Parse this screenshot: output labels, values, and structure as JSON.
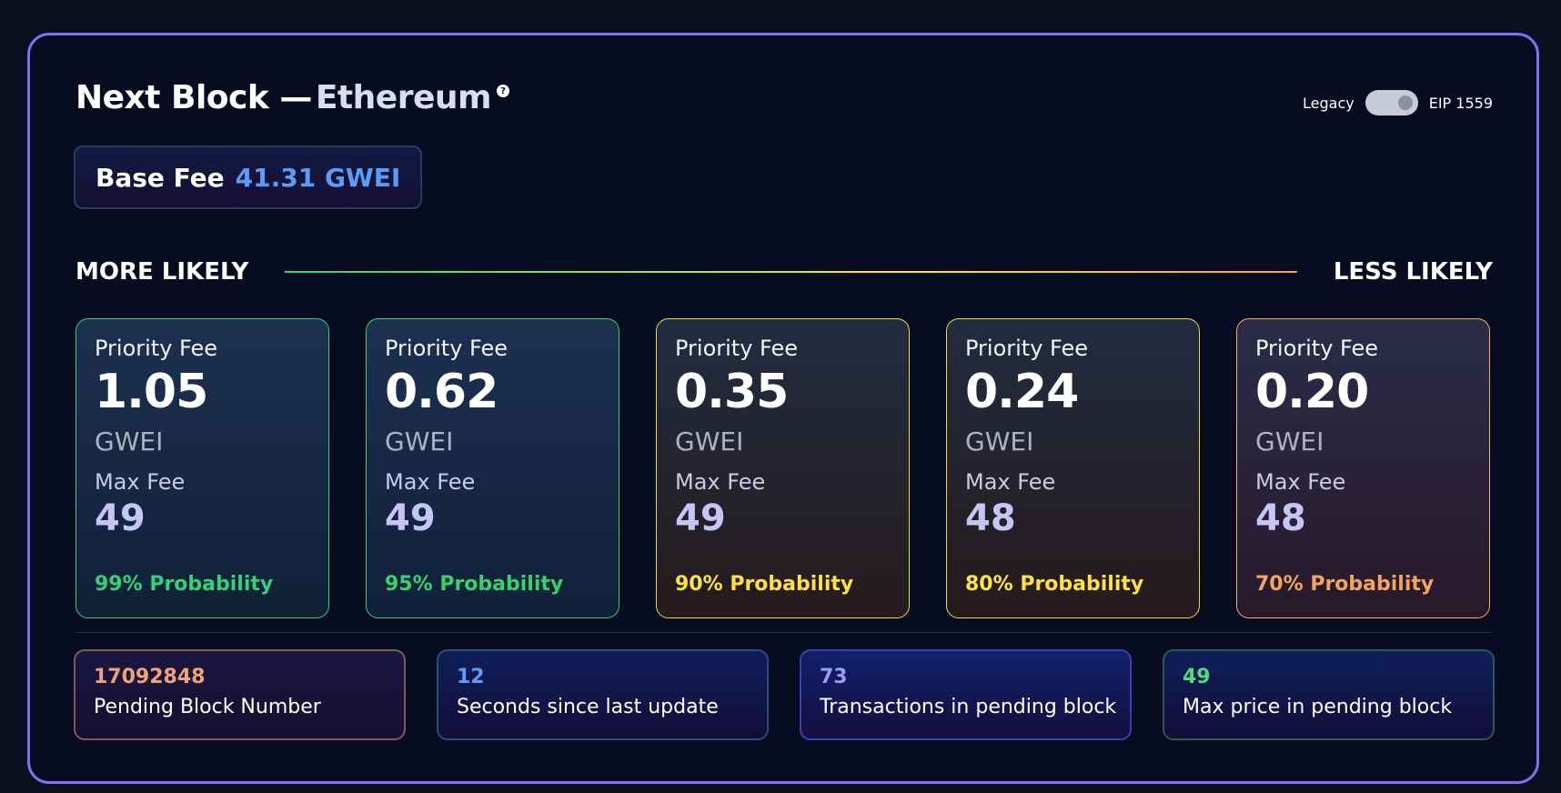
{
  "header": {
    "title": "Next Block —",
    "chain": "Ethereum",
    "help_glyph": "?",
    "toggle": {
      "left_label": "Legacy",
      "right_label": "EIP 1559",
      "state": "EIP 1559"
    }
  },
  "base_fee": {
    "label": "Base Fee",
    "value": "41.31 GWEI"
  },
  "likelihood": {
    "left": "MORE LIKELY",
    "right": "LESS LIKELY"
  },
  "cards": [
    {
      "label": "Priority Fee",
      "priority": "1.05",
      "unit": "GWEI",
      "max_label": "Max Fee",
      "max": "49",
      "probability": "99% Probability",
      "color": "#2fd37a"
    },
    {
      "label": "Priority Fee",
      "priority": "0.62",
      "unit": "GWEI",
      "max_label": "Max Fee",
      "max": "49",
      "probability": "95% Probability",
      "color": "#35d46a"
    },
    {
      "label": "Priority Fee",
      "priority": "0.35",
      "unit": "GWEI",
      "max_label": "Max Fee",
      "max": "49",
      "probability": "90% Probability",
      "color": "#ffe23c"
    },
    {
      "label": "Priority Fee",
      "priority": "0.24",
      "unit": "GWEI",
      "max_label": "Max Fee",
      "max": "48",
      "probability": "80% Probability",
      "color": "#ffe23c"
    },
    {
      "label": "Priority Fee",
      "priority": "0.20",
      "unit": "GWEI",
      "max_label": "Max Fee",
      "max": "48",
      "probability": "70% Probability",
      "color": "#f5a45c"
    }
  ],
  "stats": [
    {
      "value": "17092848",
      "label": "Pending Block Number",
      "color": "#f0a27a"
    },
    {
      "value": "12",
      "label": "Seconds since last update",
      "color": "#5c9cf5"
    },
    {
      "value": "73",
      "label": "Transactions in pending block",
      "color": "#9c9cf7"
    },
    {
      "value": "49",
      "label": "Max price in pending block",
      "color": "#4ade80"
    }
  ]
}
